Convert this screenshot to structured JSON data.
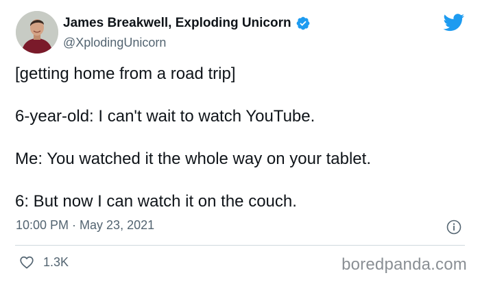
{
  "tweet": {
    "display_name": "James Breakwell, Exploding Unicorn",
    "handle": "@XplodingUnicorn",
    "lines": [
      "[getting home from a road trip]",
      "6-year-old: I can't wait to watch YouTube.",
      "Me: You watched it the whole way on your tablet.",
      "6: But now I can watch it on the couch."
    ],
    "timestamp": "10:00 PM · May 23, 2021",
    "likes": "1.3K"
  },
  "watermark": "boredpanda.com",
  "icons": {
    "verified": "verified-badge-icon",
    "brand": "twitter-bird-icon",
    "info": "info-icon",
    "like": "heart-icon"
  },
  "colors": {
    "twitter_blue": "#1d9bf0",
    "text_primary": "#0f1419",
    "text_secondary": "#536471",
    "divider": "#cfd9de",
    "avatar_shirt": "#7a1a2a"
  }
}
